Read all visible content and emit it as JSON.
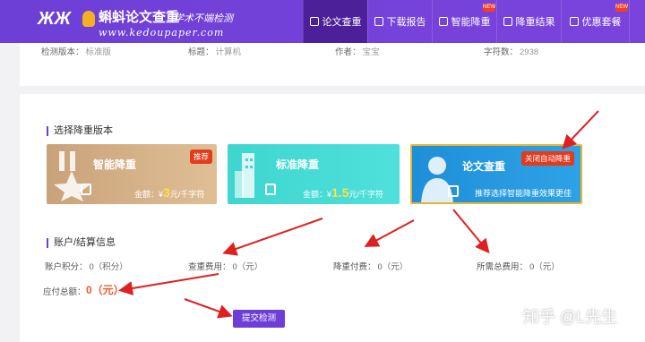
{
  "brand": {
    "title": "蝌蚪论文查重",
    "slogan": "学术不端检测",
    "url": "www.kedoupaper.com",
    "accent": "#6d3fd6"
  },
  "nav": [
    {
      "label": "论文查重",
      "icon": "document-icon",
      "active": true
    },
    {
      "label": "下载报告",
      "icon": "download-icon"
    },
    {
      "label": "智能降重",
      "icon": "document-icon",
      "badge": "NEW"
    },
    {
      "label": "降重结果",
      "icon": "document-icon"
    },
    {
      "label": "优惠套餐",
      "icon": "document-icon",
      "badge": "NEW"
    }
  ],
  "meta": [
    {
      "label": "检测版本：",
      "value": "标准版"
    },
    {
      "label": "标题：",
      "value": "计算机"
    },
    {
      "label": "作者：",
      "value": "宝宝"
    },
    {
      "label": "字符数：",
      "value": "2938"
    }
  ],
  "section_versions": "选择降重版本",
  "versions": [
    {
      "name": "智能降重",
      "tag": "推荐",
      "price_label": "金额：¥",
      "price": "3",
      "unit": "元/千字符"
    },
    {
      "name": "标准降重",
      "price_label": "金额：¥",
      "price": "1.5",
      "unit": "元/千字符"
    },
    {
      "name": "论文查重",
      "tag": "关闭自动降重",
      "note": "推荐选择智能降重效果更佳"
    }
  ],
  "section_account": "账户/结算信息",
  "account": [
    {
      "label": "账户积分：",
      "value": "0（积分）"
    },
    {
      "label": "查重费用：",
      "value": "0（元）"
    },
    {
      "label": "降重付费：",
      "value": "0（元）"
    },
    {
      "label": "所需总费用：",
      "value": "0（元）"
    }
  ],
  "total": {
    "label": "应付总额：",
    "value": "0（元）"
  },
  "submit_label": "提交检测",
  "watermark": "知乎 @L先生"
}
